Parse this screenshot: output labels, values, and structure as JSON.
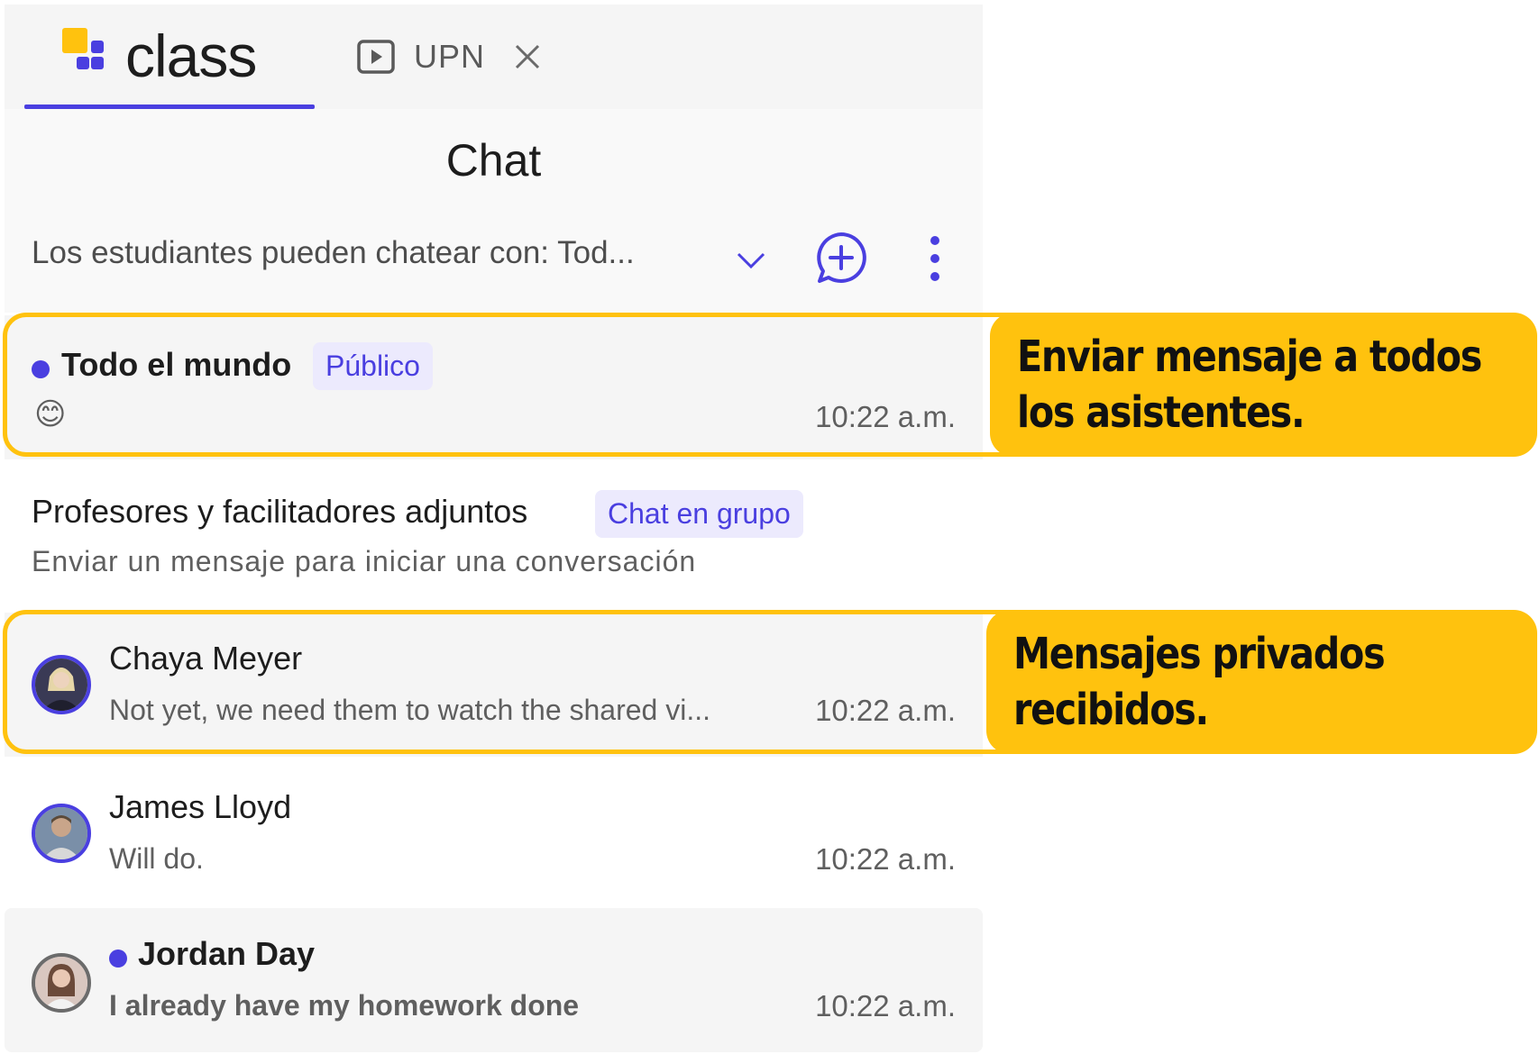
{
  "tabs": {
    "app_name": "class",
    "upn_label": "UPN"
  },
  "header": {
    "title": "Chat",
    "permission_text": "Los estudiantes pueden chatear con: Tod..."
  },
  "chats": {
    "everyone": {
      "name": "Todo el mundo",
      "badge": "Público",
      "last_message": "😊",
      "time": "10:22 a.m."
    },
    "group": {
      "name": "Profesores y facilitadores adjuntos",
      "badge": "Chat en grupo",
      "subtitle": "Enviar un mensaje para iniciar una conversación"
    },
    "chaya": {
      "name": "Chaya Meyer",
      "last_message": "Not yet, we need them to watch the shared vi...",
      "time": "10:22 a.m."
    },
    "james": {
      "name": "James Lloyd",
      "last_message": "Will do.",
      "time": "10:22 a.m."
    },
    "jordan": {
      "name": "Jordan Day",
      "last_message": "I already have my homework done",
      "time": "10:22 a.m."
    }
  },
  "callouts": {
    "everyone": "Enviar mensaje a todos los asistentes.",
    "private": "Mensajes privados recibidos."
  },
  "colors": {
    "accent": "#4a3fe0",
    "highlight": "#ffc20e"
  },
  "icons": [
    "play-icon",
    "close-icon",
    "chevron-down-icon",
    "new-chat-icon",
    "more-vertical-icon",
    "smile-emoji-icon"
  ]
}
